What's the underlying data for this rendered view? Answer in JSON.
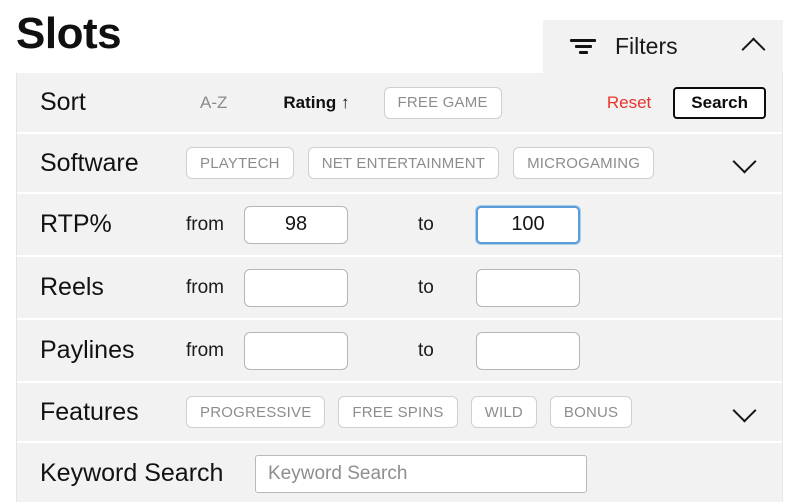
{
  "page": {
    "title": "Slots"
  },
  "filters_header": {
    "icon": "filter-icon",
    "label": "Filters",
    "toggle_icon": "chevron-up-icon"
  },
  "sort": {
    "label": "Sort",
    "options": [
      {
        "label": "A-Z",
        "active": false
      },
      {
        "label": "Rating ↑",
        "active": true
      }
    ],
    "free_game_label": "FREE GAME",
    "reset_label": "Reset",
    "search_label": "Search",
    "reset_color": "#e8332a"
  },
  "software": {
    "label": "Software",
    "options": [
      "PLAYTECH",
      "NET ENTERTAINMENT",
      "MICROGAMING"
    ],
    "toggle_icon": "chevron-down-icon"
  },
  "rtp": {
    "label": "RTP%",
    "from_word": "from",
    "to_word": "to",
    "from_value": "98",
    "to_value": "100",
    "focused_field": "to",
    "focus_color": "#5b9dd9"
  },
  "reels": {
    "label": "Reels",
    "from_word": "from",
    "to_word": "to",
    "from_value": "",
    "to_value": ""
  },
  "paylines": {
    "label": "Paylines",
    "from_word": "from",
    "to_word": "to",
    "from_value": "",
    "to_value": ""
  },
  "features": {
    "label": "Features",
    "options": [
      "PROGRESSIVE",
      "FREE SPINS",
      "WILD",
      "BONUS"
    ],
    "toggle_icon": "chevron-down-icon"
  },
  "keyword": {
    "label": "Keyword Search",
    "placeholder": "Keyword Search",
    "value": ""
  }
}
